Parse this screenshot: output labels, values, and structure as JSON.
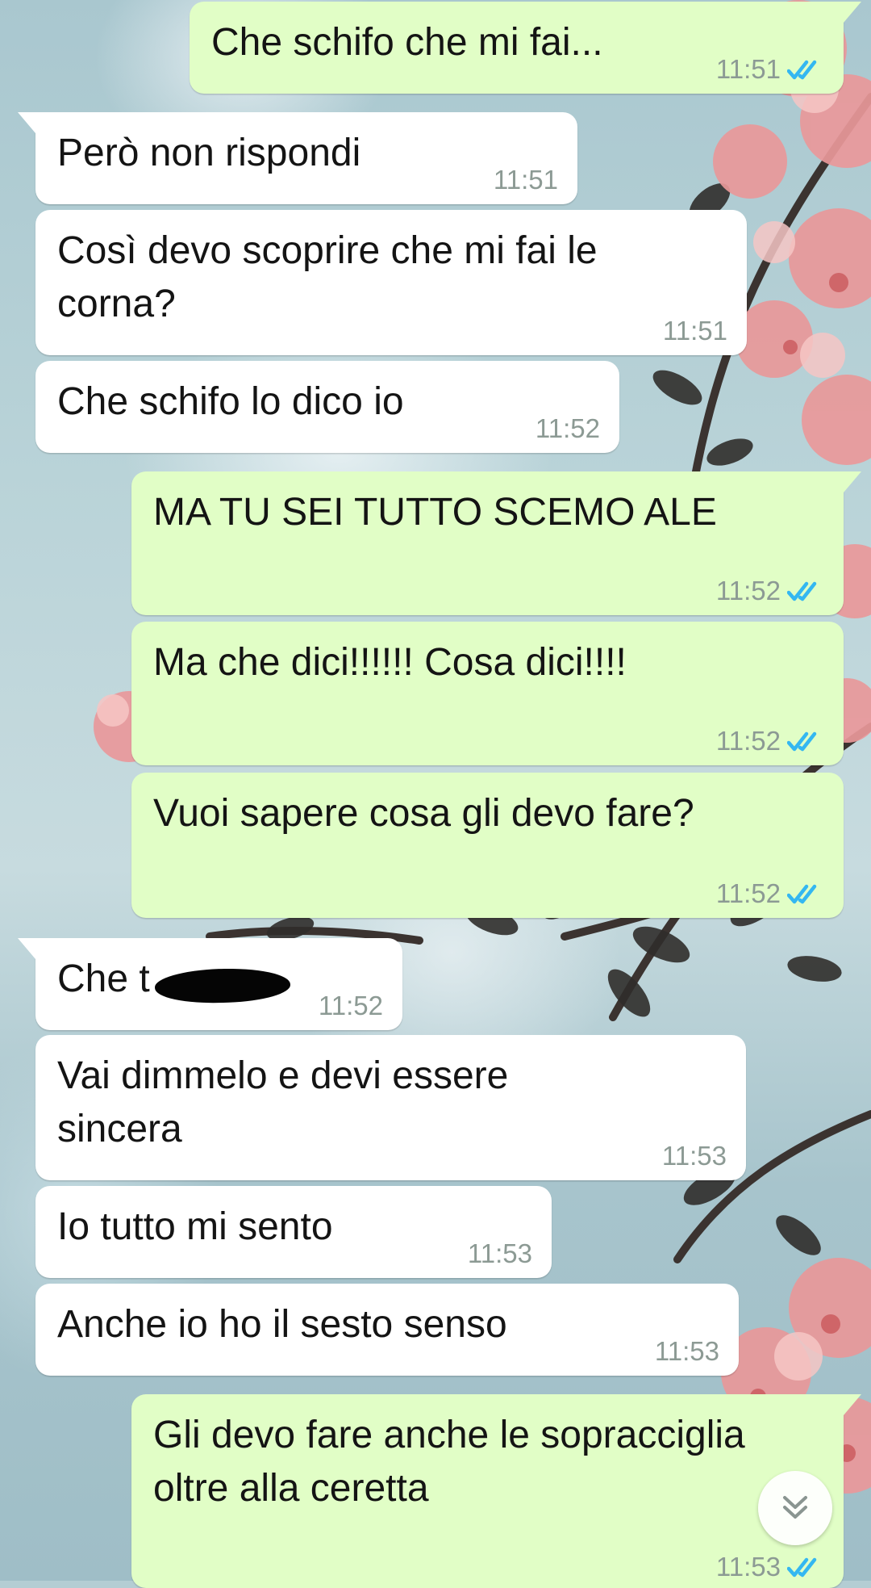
{
  "chat": {
    "messages": [
      {
        "dir": "out",
        "text": "Che schifo che mi fai...",
        "time": "11:51",
        "status": "read"
      },
      {
        "dir": "in",
        "text": "Però non rispondi",
        "time": "11:51"
      },
      {
        "dir": "in",
        "text": "Così devo scoprire che mi fai le corna?",
        "time": "11:51"
      },
      {
        "dir": "in",
        "text": "Che schifo lo dico io",
        "time": "11:52"
      },
      {
        "dir": "out",
        "text": "MA TU SEI TUTTO SCEMO ALE",
        "time": "11:52",
        "status": "read"
      },
      {
        "dir": "out",
        "text": "Ma che dici!!!!!! Cosa dici!!!!",
        "time": "11:52",
        "status": "read"
      },
      {
        "dir": "out",
        "text": "Vuoi sapere cosa gli devo fare?",
        "time": "11:52",
        "status": "read"
      },
      {
        "dir": "in",
        "text": "Che t",
        "time": "11:52",
        "redacted": true
      },
      {
        "dir": "in",
        "text": "Vai dimmelo e devi essere sincera",
        "time": "11:53"
      },
      {
        "dir": "in",
        "text": "Io tutto mi sento",
        "time": "11:53"
      },
      {
        "dir": "in",
        "text": "Anche io ho il sesto senso",
        "time": "11:53"
      },
      {
        "dir": "out",
        "text": "Gli devo fare anche le sopracciglia oltre alla ceretta",
        "time": "11:53",
        "status": "read"
      }
    ]
  },
  "icons": {
    "read_receipt": "double-check-icon",
    "scroll_down": "chevron-double-down-icon"
  },
  "colors": {
    "incoming_bubble": "#ffffff",
    "outgoing_bubble": "#e1fec6",
    "read_tick": "#34b7f1",
    "timestamp": "#8c9a94"
  }
}
